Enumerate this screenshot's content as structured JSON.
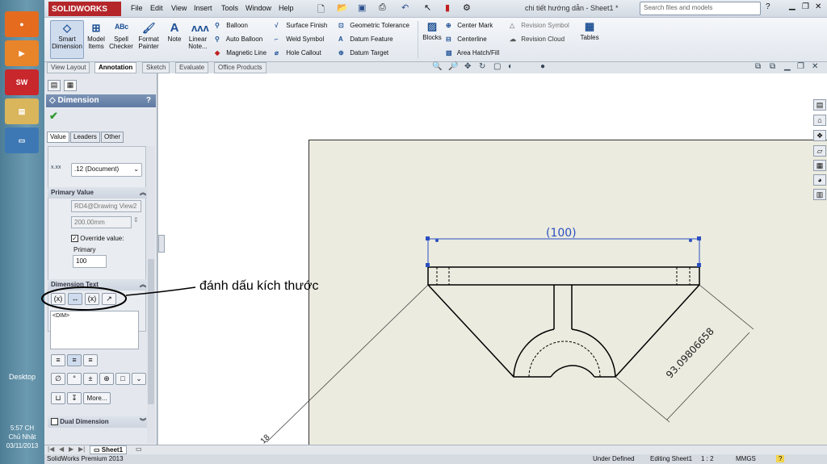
{
  "window": {
    "app_logo": "SOLIDWORKS",
    "menu": [
      "File",
      "Edit",
      "View",
      "Insert",
      "Tools",
      "Window",
      "Help"
    ],
    "doc_title": "chi tiết hướng dẫn - Sheet1 *",
    "search_placeholder": "Search files and models"
  },
  "ribbon": {
    "smart_dimension": "Smart Dimension",
    "model_items": "Model Items",
    "spell_checker": "Spell Checker",
    "format_painter": "Format Painter",
    "note": "Note",
    "linear_note": "Linear Note...",
    "balloon": "Balloon",
    "auto_balloon": "Auto Balloon",
    "magnetic_line": "Magnetic Line",
    "surface_finish": "Surface Finish",
    "weld_symbol": "Weld Symbol",
    "hole_callout": "Hole Callout",
    "geometric_tolerance": "Geometric Tolerance",
    "datum_feature": "Datum Feature",
    "datum_target": "Datum Target",
    "blocks": "Blocks",
    "center_mark": "Center Mark",
    "centerline": "Centerline",
    "area_hatch": "Area Hatch/Fill",
    "revision_symbol": "Revision Symbol",
    "revision_cloud": "Revision Cloud",
    "tables": "Tables"
  },
  "command_tabs": [
    "View Layout",
    "Annotation",
    "Sketch",
    "Evaluate",
    "Office Products"
  ],
  "property_manager": {
    "title": "Dimension",
    "help": "?",
    "tabs": [
      "Value",
      "Leaders",
      "Other"
    ],
    "tolerance_precision": ".12 (Document)",
    "primary_value": {
      "header": "Primary Value",
      "reference": "RD4@Drawing View2",
      "value": "200.00mm",
      "override_label": "Override value:",
      "primary_label": "Primary",
      "primary_value": "100"
    },
    "dimension_text": {
      "header": "Dimension Text",
      "text": "<DIM>",
      "more": "More..."
    },
    "dual_dimension": "Dual Dimension"
  },
  "annotation_callout": "đánh dấu kích thước",
  "drawing": {
    "dim_top": "(100)",
    "dim_diag": "93.09806658",
    "dim_partial": "18"
  },
  "sheet_tab": "Sheet1",
  "status": {
    "app": "SolidWorks Premium 2013",
    "state": "Under Defined",
    "editing": "Editing Sheet1",
    "scale": "1 : 2",
    "units": "MMGS",
    "help": "?"
  },
  "taskbar": {
    "desktop": "Desktop",
    "time": "5:57 CH",
    "day": "Chủ Nhật",
    "date": "03/11/2013"
  }
}
